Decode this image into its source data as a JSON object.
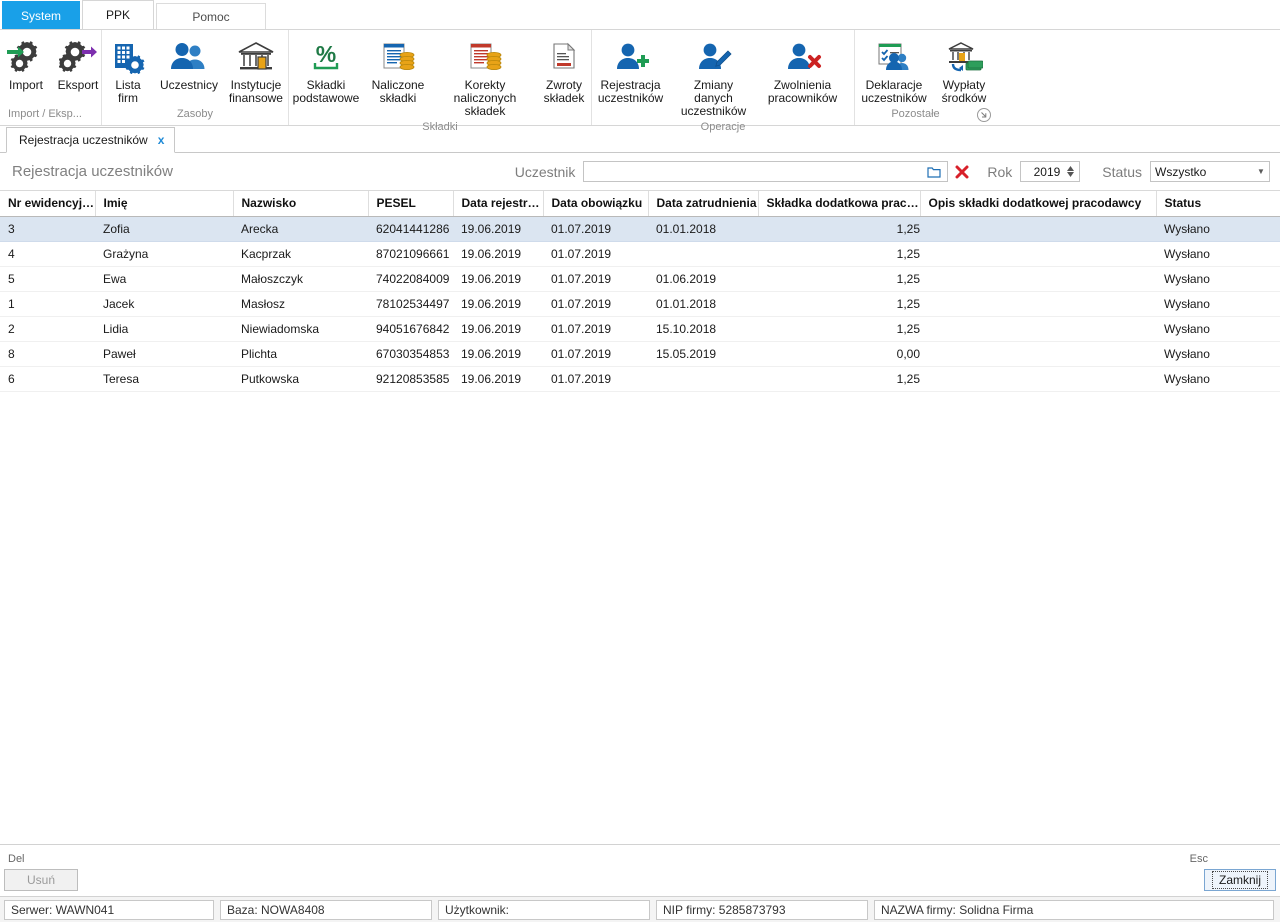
{
  "ribbon": {
    "tabs": [
      {
        "label": "System",
        "state": "system"
      },
      {
        "label": "PPK",
        "state": "active"
      },
      {
        "label": "Pomoc",
        "state": "idle"
      }
    ],
    "groups": [
      {
        "label": "Import / Eksp...",
        "buttons": [
          {
            "label": "Import",
            "icon": "import-gears-icon"
          },
          {
            "label": "Eksport",
            "icon": "export-gears-icon"
          }
        ]
      },
      {
        "label": "Zasoby",
        "buttons": [
          {
            "label": "Lista\nfirm",
            "line1": "Lista",
            "line2": "firm",
            "icon": "building-gear-icon"
          },
          {
            "label": "Uczestnicy",
            "line1": "Uczestnicy",
            "line2": "",
            "icon": "people-icon"
          },
          {
            "label": "Instytucje finansowe",
            "line1": "Instytucje",
            "line2": "finansowe",
            "icon": "bank-icon"
          }
        ]
      },
      {
        "label": "Składki",
        "buttons": [
          {
            "label": "Składki podstawowe",
            "line1": "Składki",
            "line2": "podstawowe",
            "icon": "percent-icon"
          },
          {
            "label": "Naliczone składki",
            "line1": "Naliczone",
            "line2": "składki",
            "icon": "document-coins-blue-icon"
          },
          {
            "label": "Korekty naliczonych składek",
            "line1": "Korekty naliczonych",
            "line2": "składek",
            "icon": "document-coins-red-icon"
          },
          {
            "label": "Zwroty składek",
            "line1": "Zwroty",
            "line2": "składek",
            "icon": "document-return-icon"
          }
        ]
      },
      {
        "label": "Operacje",
        "buttons": [
          {
            "label": "Rejestracja uczestników",
            "line1": "Rejestracja",
            "line2": "uczestników",
            "icon": "person-add-icon"
          },
          {
            "label": "Zmiany danych uczestników",
            "line1": "Zmiany danych",
            "line2": "uczestników",
            "icon": "person-edit-icon"
          },
          {
            "label": "Zwolnienia pracowników",
            "line1": "Zwolnienia",
            "line2": "pracowników",
            "icon": "person-remove-icon"
          }
        ]
      },
      {
        "label": "Pozostałe",
        "buttons": [
          {
            "label": "Deklaracje uczestników",
            "line1": "Deklaracje",
            "line2": "uczestników",
            "icon": "checklist-people-icon"
          },
          {
            "label": "Wypłaty środków",
            "line1": "Wypłaty",
            "line2": "środków",
            "icon": "bank-money-icon"
          }
        ]
      }
    ]
  },
  "doctab": {
    "label": "Rejestracja uczestników",
    "close": "x"
  },
  "filter": {
    "view_title": "Rejestracja uczestników",
    "uczestnik_label": "Uczestnik",
    "uczestnik_value": "",
    "uczestnik_placeholder": "",
    "browse_icon": "folder-icon",
    "clear_icon": "clear-x-icon",
    "rok_label": "Rok",
    "rok_value": "2019",
    "status_label": "Status",
    "status_value": "Wszystko"
  },
  "grid": {
    "columns": [
      "Nr ewidencyjny",
      "Imię",
      "Nazwisko",
      "PESEL",
      "Data rejestracji",
      "Data obowiązku",
      "Data zatrudnienia",
      "Składka dodatkowa pracod...",
      "Opis składki dodatkowej pracodawcy",
      "Status"
    ],
    "rows": [
      {
        "selected": true,
        "nr": "3",
        "imie": "Zofia",
        "nazwisko": "Arecka",
        "pesel": "62041441286",
        "data_rej": "19.06.2019",
        "data_obow": "01.07.2019",
        "data_zatr": "01.01.2018",
        "skladka": "1,25",
        "opis": "",
        "status": "Wysłano"
      },
      {
        "selected": false,
        "nr": "4",
        "imie": "Grażyna",
        "nazwisko": "Kacprzak",
        "pesel": "87021096661",
        "data_rej": "19.06.2019",
        "data_obow": "01.07.2019",
        "data_zatr": "",
        "skladka": "1,25",
        "opis": "",
        "status": "Wysłano"
      },
      {
        "selected": false,
        "nr": "5",
        "imie": "Ewa",
        "nazwisko": "Małoszczyk",
        "pesel": "74022084009",
        "data_rej": "19.06.2019",
        "data_obow": "01.07.2019",
        "data_zatr": "01.06.2019",
        "skladka": "1,25",
        "opis": "",
        "status": "Wysłano"
      },
      {
        "selected": false,
        "nr": "1",
        "imie": "Jacek",
        "nazwisko": "Masłosz",
        "pesel": "78102534497",
        "data_rej": "19.06.2019",
        "data_obow": "01.07.2019",
        "data_zatr": "01.01.2018",
        "skladka": "1,25",
        "opis": "",
        "status": "Wysłano"
      },
      {
        "selected": false,
        "nr": "2",
        "imie": "Lidia",
        "nazwisko": "Niewiadomska",
        "pesel": "94051676842",
        "data_rej": "19.06.2019",
        "data_obow": "01.07.2019",
        "data_zatr": "15.10.2018",
        "skladka": "1,25",
        "opis": "",
        "status": "Wysłano"
      },
      {
        "selected": false,
        "nr": "8",
        "imie": "Paweł",
        "nazwisko": "Plichta",
        "pesel": "67030354853",
        "data_rej": "19.06.2019",
        "data_obow": "01.07.2019",
        "data_zatr": "15.05.2019",
        "skladka": "0,00",
        "opis": "",
        "status": "Wysłano"
      },
      {
        "selected": false,
        "nr": "6",
        "imie": "Teresa",
        "nazwisko": "Putkowska",
        "pesel": "92120853585",
        "data_rej": "19.06.2019",
        "data_obow": "01.07.2019",
        "data_zatr": "",
        "skladka": "1,25",
        "opis": "",
        "status": "Wysłano"
      }
    ]
  },
  "actions": {
    "delete_key": "Del",
    "delete_label": "Usuń",
    "close_key": "Esc",
    "close_label": "Zamknij"
  },
  "statusbar": {
    "server": "Serwer: WAWN041",
    "database": "Baza: NOWA8408",
    "user": "Użytkownik:",
    "nip": "NIP firmy: 5285873793",
    "company": "NAZWA firmy: Solidna Firma"
  },
  "colors": {
    "system_tab": "#19a0e8",
    "selection": "#dbe5f1",
    "accent_blue": "#1f8ad6",
    "red": "#d8202a",
    "green": "#1f9c54"
  }
}
